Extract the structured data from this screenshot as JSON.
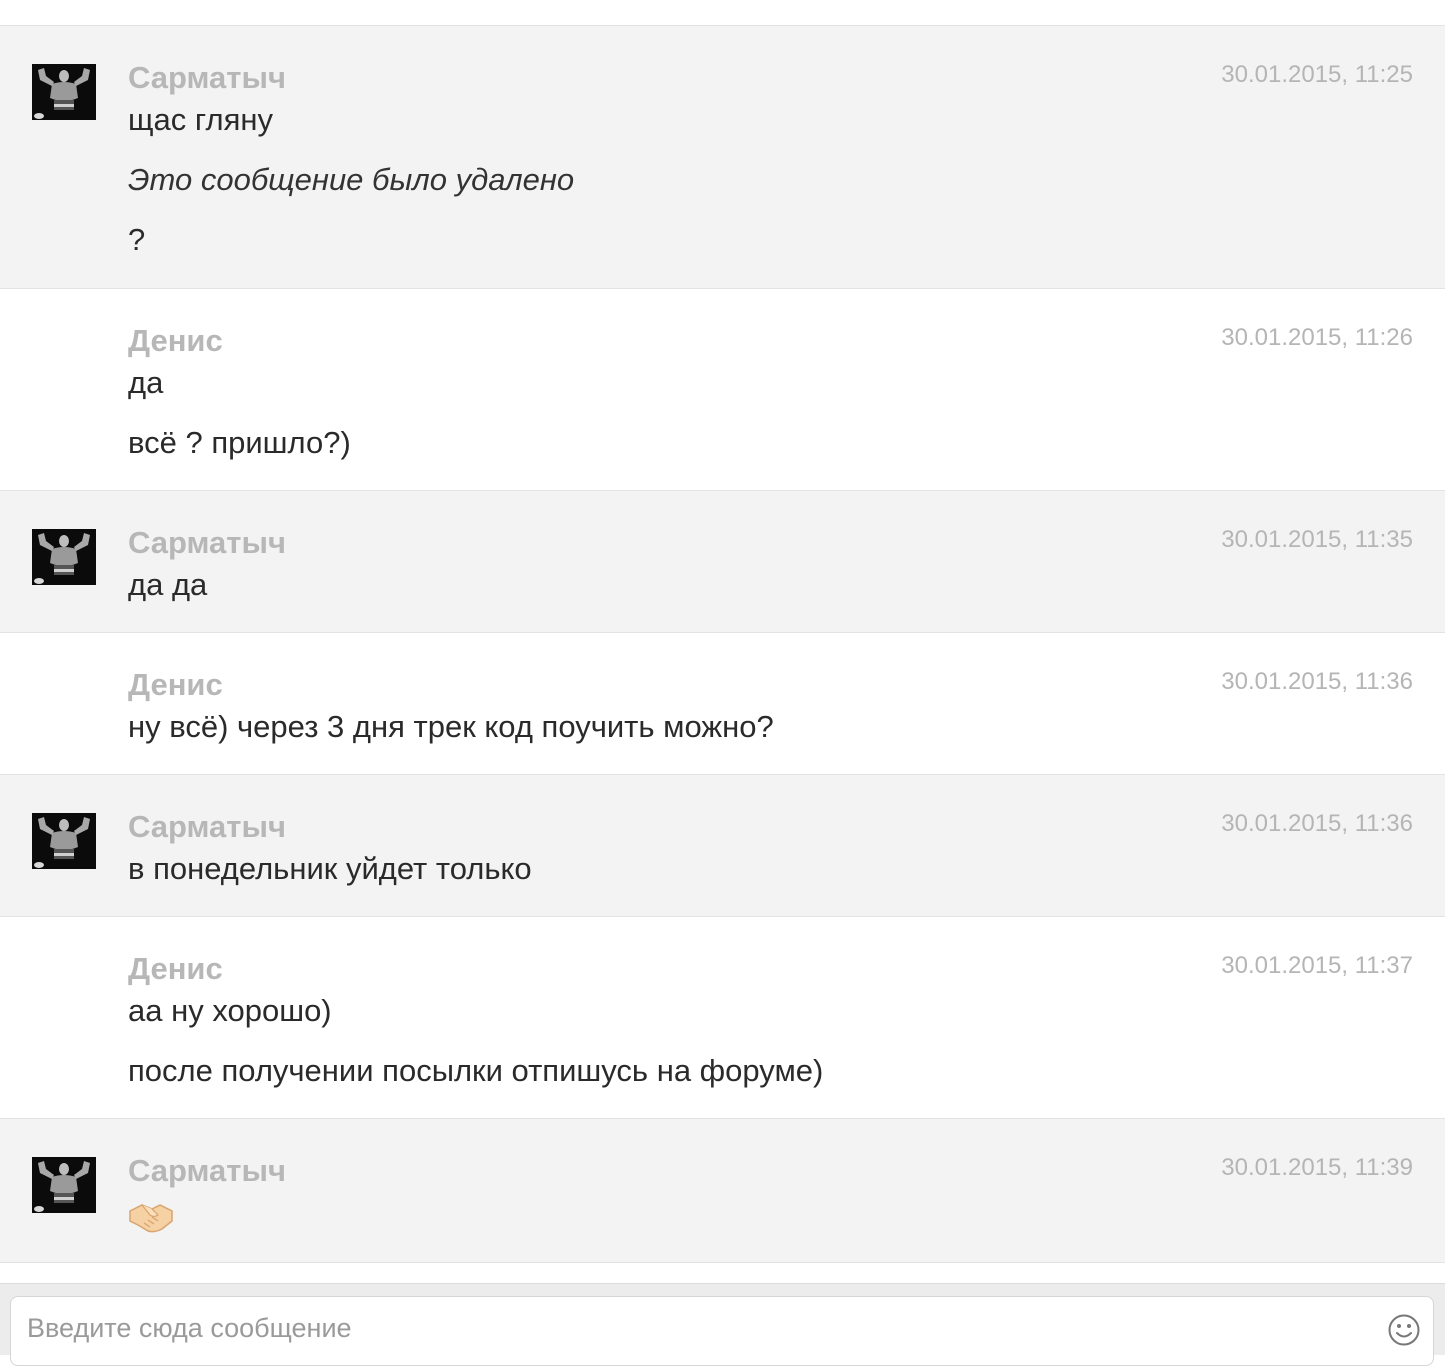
{
  "composer": {
    "placeholder": "Введите сюда сообщение",
    "emoji_button_icon": "smiley-icon"
  },
  "messages": [
    {
      "author": "Сарматыч",
      "time": "30.01.2015, 11:25",
      "has_avatar": true,
      "lines": [
        "щас гляну",
        "Это сообщение было удалено",
        "?"
      ]
    },
    {
      "author": "Денис",
      "time": "30.01.2015, 11:26",
      "has_avatar": false,
      "lines": [
        "да",
        "всё ? пришло?)"
      ]
    },
    {
      "author": "Сарматыч",
      "time": "30.01.2015, 11:35",
      "has_avatar": true,
      "lines": [
        "да да"
      ]
    },
    {
      "author": "Денис",
      "time": "30.01.2015, 11:36",
      "has_avatar": false,
      "lines": [
        "ну всё) через 3 дня трек код поучить можно?"
      ]
    },
    {
      "author": "Сарматыч",
      "time": "30.01.2015, 11:36",
      "has_avatar": true,
      "lines": [
        "в понедельник уйдет только"
      ]
    },
    {
      "author": "Денис",
      "time": "30.01.2015, 11:37",
      "has_avatar": false,
      "lines": [
        "аа ну хорошо)",
        "после получении посылки отпишусь на форуме)"
      ]
    },
    {
      "author": "Сарматыч",
      "time": "30.01.2015, 11:39",
      "has_avatar": true,
      "emoji": "handshake-emoji"
    }
  ]
}
